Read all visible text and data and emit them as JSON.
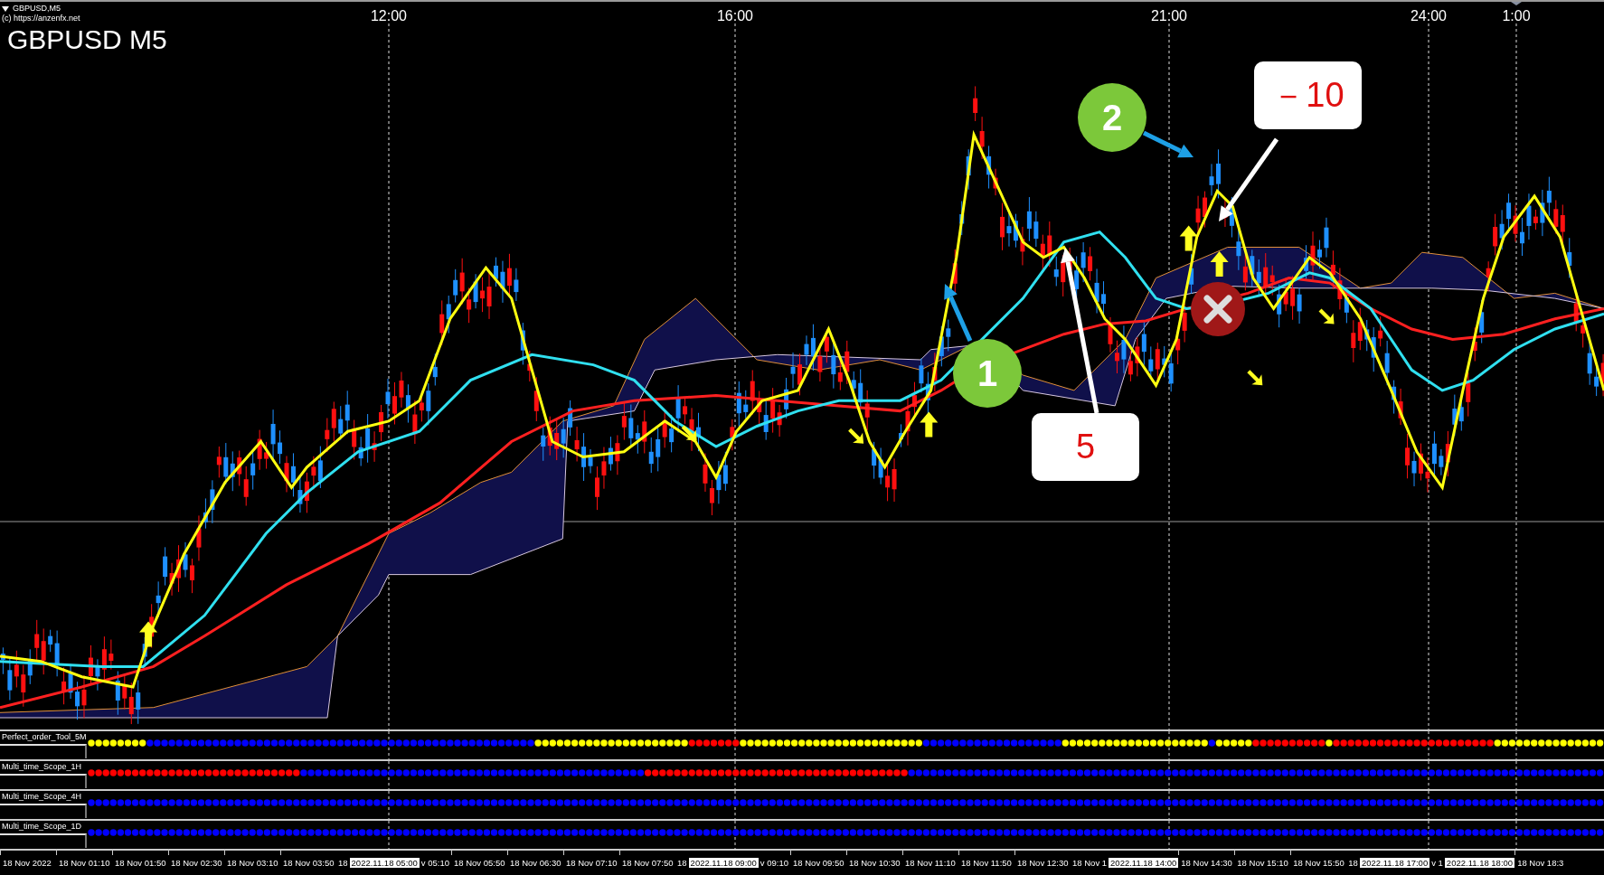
{
  "window": {
    "title": "GBPUSD,M5",
    "copyright": "(c) https://anzenfx.net"
  },
  "chart": {
    "symbol_label": "GBPUSD M5",
    "time_labels": [
      "12:00",
      "16:00",
      "21:00",
      "24:00",
      "1:00"
    ]
  },
  "callouts": [
    {
      "kind": "circle",
      "label": "1"
    },
    {
      "kind": "circle",
      "label": "2"
    },
    {
      "kind": "box",
      "label": "5"
    },
    {
      "kind": "box",
      "label": "－10"
    }
  ],
  "indicators": [
    {
      "name": "Perfect_order_Tool_5M"
    },
    {
      "name": "Multi_time_Scope_1H"
    },
    {
      "name": "Multi_time_Scope_4H"
    },
    {
      "name": "Multi_time_Scope_1D"
    }
  ],
  "time_axis": [
    {
      "kind": "tick",
      "label": "18 Nov 2022"
    },
    {
      "kind": "tick",
      "label": "18 Nov 01:10"
    },
    {
      "kind": "tick",
      "label": "18 Nov 01:50"
    },
    {
      "kind": "tick",
      "label": "18 Nov 02:30"
    },
    {
      "kind": "tick",
      "label": "18 Nov 03:10"
    },
    {
      "kind": "tick",
      "label": "18 Nov 03:50"
    },
    {
      "kind": "partial",
      "label": "18"
    },
    {
      "kind": "marker",
      "label": "2022.11.18 05:00"
    },
    {
      "kind": "partial",
      "label": "v 05:10"
    },
    {
      "kind": "tick",
      "label": "18 Nov 05:50"
    },
    {
      "kind": "tick",
      "label": "18 Nov 06:30"
    },
    {
      "kind": "tick",
      "label": "18 Nov 07:10"
    },
    {
      "kind": "tick",
      "label": "18 Nov 07:50"
    },
    {
      "kind": "partial",
      "label": "18"
    },
    {
      "kind": "marker",
      "label": "2022.11.18 09:00"
    },
    {
      "kind": "partial",
      "label": "v 09:10"
    },
    {
      "kind": "tick",
      "label": "18 Nov 09:50"
    },
    {
      "kind": "tick",
      "label": "18 Nov 10:30"
    },
    {
      "kind": "tick",
      "label": "18 Nov 11:10"
    },
    {
      "kind": "tick",
      "label": "18 Nov 11:50"
    },
    {
      "kind": "tick",
      "label": "18 Nov 12:30"
    },
    {
      "kind": "partial",
      "label": "18 Nov 1"
    },
    {
      "kind": "marker",
      "label": "2022.11.18 14:00"
    },
    {
      "kind": "tick",
      "label": "18 Nov 14:30"
    },
    {
      "kind": "tick",
      "label": "18 Nov 15:10"
    },
    {
      "kind": "tick",
      "label": "18 Nov 15:50"
    },
    {
      "kind": "partial",
      "label": "18"
    },
    {
      "kind": "marker",
      "label": "2022.11.18 17:00"
    },
    {
      "kind": "partial",
      "label": "v 1"
    },
    {
      "kind": "marker",
      "label": "2022.11.18 18:00"
    },
    {
      "kind": "tick",
      "label": "18 Nov 18:3"
    }
  ]
}
